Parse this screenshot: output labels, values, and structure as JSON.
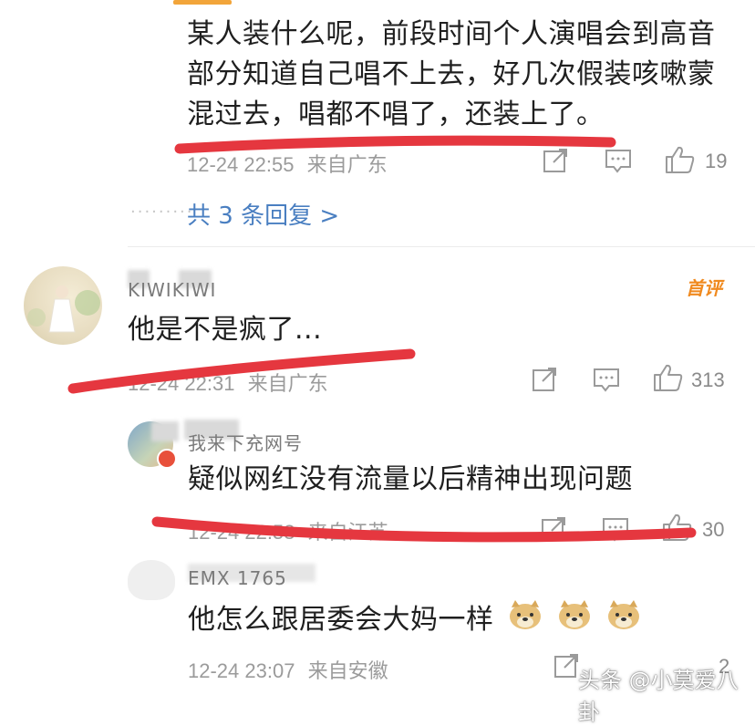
{
  "comments": [
    {
      "text_lines": [
        "某人装什么呢，前段时间个人演唱会到高音",
        "部分知道自己唱不上去，好几次假装咳嗽蒙",
        "混过去，唱都不唱了，还装上了。"
      ],
      "time": "12-24 22:55",
      "location": "来自广东",
      "likes": "19",
      "more_replies": "共 3 条回复 >"
    },
    {
      "username": "KIWIKIWI",
      "badge": "首评",
      "text": "他是不是疯了...",
      "time": "12-24 22:31",
      "location": "来自广东",
      "likes": "313"
    },
    {
      "username": "我来下充网号",
      "text": "疑似网红没有流量以后精神出现问题",
      "time": "12-24 22:58",
      "location": "来自江苏",
      "likes": "30"
    },
    {
      "username": "EMX 1765",
      "text": "他怎么跟居委会大妈一样",
      "emoji": "doge",
      "time": "12-24 23:07",
      "location": "来自安徽",
      "likes": "2"
    }
  ],
  "watermark": "头条 @小莫爱八卦",
  "colors": {
    "accent_line": "#e5373f",
    "link": "#4a7fc1",
    "badge": "#f08a1f"
  },
  "icons": [
    "share-icon",
    "comment-icon",
    "thumbs-up-icon",
    "doge-emoji"
  ]
}
